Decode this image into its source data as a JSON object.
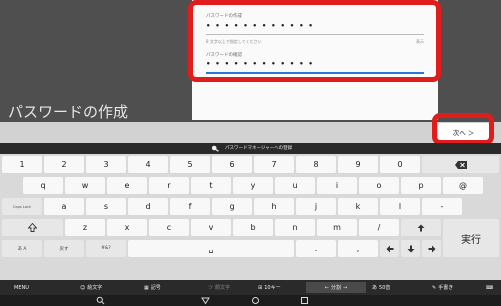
{
  "screen": {
    "title": "パスワードの作成",
    "form": {
      "password_label": "パスワードの作成",
      "password_value": "• • • • • • • • • • • •",
      "hint": "8 文字以上で指定してください",
      "hint_right": "表示",
      "confirm_label": "パスワードの確認",
      "confirm_value": "• • • • • • • • • • • •"
    },
    "next_button": "次へ ＞"
  },
  "keyboard": {
    "suggestion": "パスワードマネージャーへの登録",
    "row1": [
      "1",
      "2",
      "3",
      "4",
      "5",
      "6",
      "7",
      "8",
      "9",
      "0"
    ],
    "row2": [
      "q",
      "w",
      "e",
      "r",
      "t",
      "y",
      "u",
      "i",
      "o",
      "p",
      "@"
    ],
    "row3": [
      "a",
      "s",
      "d",
      "f",
      "g",
      "h",
      "j",
      "k",
      "l",
      "-"
    ],
    "row4": [
      "z",
      "x",
      "c",
      "v",
      "b",
      "n",
      "m",
      "/"
    ],
    "caps_label": "Caps Lock",
    "enter_label": "実行",
    "kana_label": "あ A",
    "undo_label": "戻す",
    "symbols_label": "#&?",
    "space_label": "␣",
    "dot_label": ".",
    "comma_label": ",",
    "bottom": {
      "menu": "MENU",
      "emoji": "絵文字",
      "kigo": "記号",
      "kaomoji": "顔文字",
      "tenkey": "10キー",
      "split": "分割",
      "fifty": "50音",
      "handwriting": "手書き"
    }
  },
  "colors": {
    "highlight": "#e11c1c",
    "accent": "#2b77d8",
    "keyboard_bg": "#d9d9d9"
  }
}
